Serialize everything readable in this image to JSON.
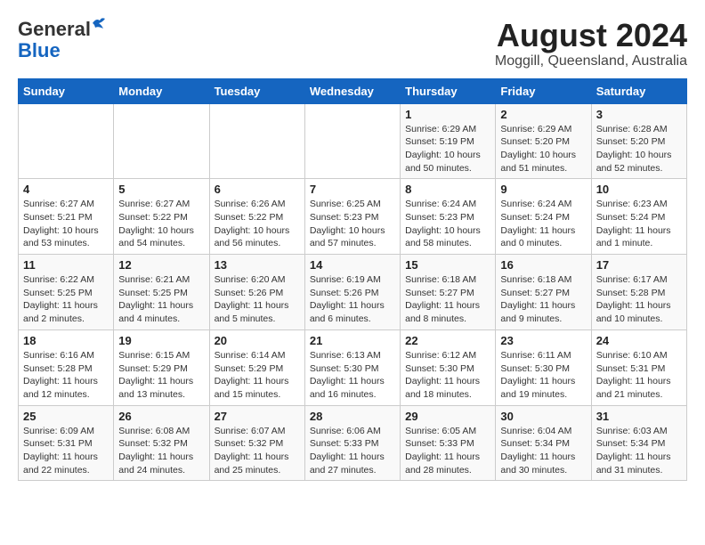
{
  "header": {
    "logo_line1": "General",
    "logo_line2": "Blue",
    "month_year": "August 2024",
    "location": "Moggill, Queensland, Australia"
  },
  "days_of_week": [
    "Sunday",
    "Monday",
    "Tuesday",
    "Wednesday",
    "Thursday",
    "Friday",
    "Saturday"
  ],
  "weeks": [
    [
      {
        "day": "",
        "sunrise": "",
        "sunset": "",
        "daylight": ""
      },
      {
        "day": "",
        "sunrise": "",
        "sunset": "",
        "daylight": ""
      },
      {
        "day": "",
        "sunrise": "",
        "sunset": "",
        "daylight": ""
      },
      {
        "day": "",
        "sunrise": "",
        "sunset": "",
        "daylight": ""
      },
      {
        "day": "1",
        "sunrise": "Sunrise: 6:29 AM",
        "sunset": "Sunset: 5:19 PM",
        "daylight": "Daylight: 10 hours and 50 minutes."
      },
      {
        "day": "2",
        "sunrise": "Sunrise: 6:29 AM",
        "sunset": "Sunset: 5:20 PM",
        "daylight": "Daylight: 10 hours and 51 minutes."
      },
      {
        "day": "3",
        "sunrise": "Sunrise: 6:28 AM",
        "sunset": "Sunset: 5:20 PM",
        "daylight": "Daylight: 10 hours and 52 minutes."
      }
    ],
    [
      {
        "day": "4",
        "sunrise": "Sunrise: 6:27 AM",
        "sunset": "Sunset: 5:21 PM",
        "daylight": "Daylight: 10 hours and 53 minutes."
      },
      {
        "day": "5",
        "sunrise": "Sunrise: 6:27 AM",
        "sunset": "Sunset: 5:22 PM",
        "daylight": "Daylight: 10 hours and 54 minutes."
      },
      {
        "day": "6",
        "sunrise": "Sunrise: 6:26 AM",
        "sunset": "Sunset: 5:22 PM",
        "daylight": "Daylight: 10 hours and 56 minutes."
      },
      {
        "day": "7",
        "sunrise": "Sunrise: 6:25 AM",
        "sunset": "Sunset: 5:23 PM",
        "daylight": "Daylight: 10 hours and 57 minutes."
      },
      {
        "day": "8",
        "sunrise": "Sunrise: 6:24 AM",
        "sunset": "Sunset: 5:23 PM",
        "daylight": "Daylight: 10 hours and 58 minutes."
      },
      {
        "day": "9",
        "sunrise": "Sunrise: 6:24 AM",
        "sunset": "Sunset: 5:24 PM",
        "daylight": "Daylight: 11 hours and 0 minutes."
      },
      {
        "day": "10",
        "sunrise": "Sunrise: 6:23 AM",
        "sunset": "Sunset: 5:24 PM",
        "daylight": "Daylight: 11 hours and 1 minute."
      }
    ],
    [
      {
        "day": "11",
        "sunrise": "Sunrise: 6:22 AM",
        "sunset": "Sunset: 5:25 PM",
        "daylight": "Daylight: 11 hours and 2 minutes."
      },
      {
        "day": "12",
        "sunrise": "Sunrise: 6:21 AM",
        "sunset": "Sunset: 5:25 PM",
        "daylight": "Daylight: 11 hours and 4 minutes."
      },
      {
        "day": "13",
        "sunrise": "Sunrise: 6:20 AM",
        "sunset": "Sunset: 5:26 PM",
        "daylight": "Daylight: 11 hours and 5 minutes."
      },
      {
        "day": "14",
        "sunrise": "Sunrise: 6:19 AM",
        "sunset": "Sunset: 5:26 PM",
        "daylight": "Daylight: 11 hours and 6 minutes."
      },
      {
        "day": "15",
        "sunrise": "Sunrise: 6:18 AM",
        "sunset": "Sunset: 5:27 PM",
        "daylight": "Daylight: 11 hours and 8 minutes."
      },
      {
        "day": "16",
        "sunrise": "Sunrise: 6:18 AM",
        "sunset": "Sunset: 5:27 PM",
        "daylight": "Daylight: 11 hours and 9 minutes."
      },
      {
        "day": "17",
        "sunrise": "Sunrise: 6:17 AM",
        "sunset": "Sunset: 5:28 PM",
        "daylight": "Daylight: 11 hours and 10 minutes."
      }
    ],
    [
      {
        "day": "18",
        "sunrise": "Sunrise: 6:16 AM",
        "sunset": "Sunset: 5:28 PM",
        "daylight": "Daylight: 11 hours and 12 minutes."
      },
      {
        "day": "19",
        "sunrise": "Sunrise: 6:15 AM",
        "sunset": "Sunset: 5:29 PM",
        "daylight": "Daylight: 11 hours and 13 minutes."
      },
      {
        "day": "20",
        "sunrise": "Sunrise: 6:14 AM",
        "sunset": "Sunset: 5:29 PM",
        "daylight": "Daylight: 11 hours and 15 minutes."
      },
      {
        "day": "21",
        "sunrise": "Sunrise: 6:13 AM",
        "sunset": "Sunset: 5:30 PM",
        "daylight": "Daylight: 11 hours and 16 minutes."
      },
      {
        "day": "22",
        "sunrise": "Sunrise: 6:12 AM",
        "sunset": "Sunset: 5:30 PM",
        "daylight": "Daylight: 11 hours and 18 minutes."
      },
      {
        "day": "23",
        "sunrise": "Sunrise: 6:11 AM",
        "sunset": "Sunset: 5:30 PM",
        "daylight": "Daylight: 11 hours and 19 minutes."
      },
      {
        "day": "24",
        "sunrise": "Sunrise: 6:10 AM",
        "sunset": "Sunset: 5:31 PM",
        "daylight": "Daylight: 11 hours and 21 minutes."
      }
    ],
    [
      {
        "day": "25",
        "sunrise": "Sunrise: 6:09 AM",
        "sunset": "Sunset: 5:31 PM",
        "daylight": "Daylight: 11 hours and 22 minutes."
      },
      {
        "day": "26",
        "sunrise": "Sunrise: 6:08 AM",
        "sunset": "Sunset: 5:32 PM",
        "daylight": "Daylight: 11 hours and 24 minutes."
      },
      {
        "day": "27",
        "sunrise": "Sunrise: 6:07 AM",
        "sunset": "Sunset: 5:32 PM",
        "daylight": "Daylight: 11 hours and 25 minutes."
      },
      {
        "day": "28",
        "sunrise": "Sunrise: 6:06 AM",
        "sunset": "Sunset: 5:33 PM",
        "daylight": "Daylight: 11 hours and 27 minutes."
      },
      {
        "day": "29",
        "sunrise": "Sunrise: 6:05 AM",
        "sunset": "Sunset: 5:33 PM",
        "daylight": "Daylight: 11 hours and 28 minutes."
      },
      {
        "day": "30",
        "sunrise": "Sunrise: 6:04 AM",
        "sunset": "Sunset: 5:34 PM",
        "daylight": "Daylight: 11 hours and 30 minutes."
      },
      {
        "day": "31",
        "sunrise": "Sunrise: 6:03 AM",
        "sunset": "Sunset: 5:34 PM",
        "daylight": "Daylight: 11 hours and 31 minutes."
      }
    ]
  ]
}
